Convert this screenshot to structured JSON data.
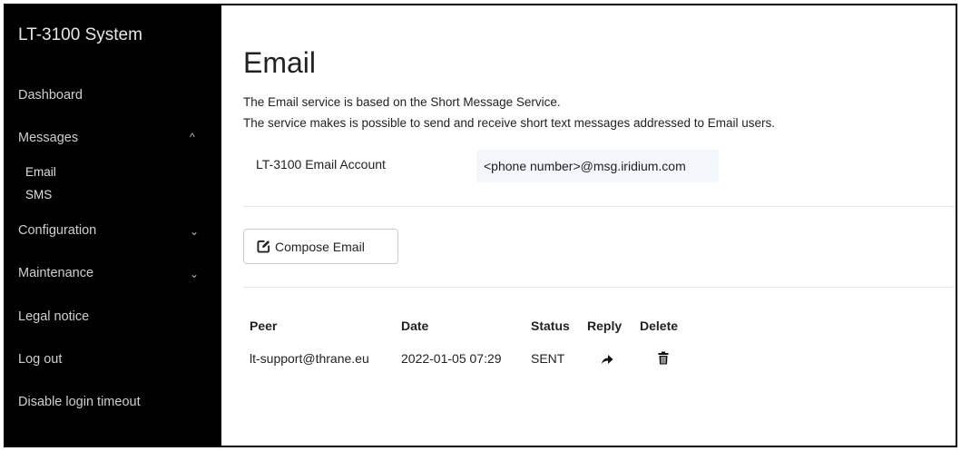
{
  "sidebar": {
    "brand": "LT-3100 System",
    "items": {
      "dashboard": "Dashboard",
      "messages": "Messages",
      "email": "Email",
      "sms": "SMS",
      "configuration": "Configuration",
      "maintenance": "Maintenance",
      "legal_notice": "Legal notice",
      "log_out": "Log out",
      "disable_timeout": "Disable login timeout"
    },
    "chevrons": {
      "messages": "^",
      "configuration": "⌄",
      "maintenance": "⌄"
    }
  },
  "main": {
    "title": "Email",
    "description": [
      "The Email service is based on the Short Message Service.",
      "The service makes is possible to send and receive short text messages addressed to Email users."
    ],
    "account": {
      "label": "LT-3100 Email Account",
      "value": "<phone number>@msg.iridium.com"
    },
    "compose_label": "Compose Email",
    "table": {
      "headers": [
        "Peer",
        "Date",
        "Status",
        "Reply",
        "Delete"
      ],
      "rows": [
        {
          "peer": "lt-support@thrane.eu",
          "date": "2022-01-05 07:29",
          "status": "SENT"
        }
      ]
    }
  },
  "icons": {
    "compose": "edit-icon",
    "reply": "reply-arrow-icon",
    "delete": "trash-icon"
  }
}
